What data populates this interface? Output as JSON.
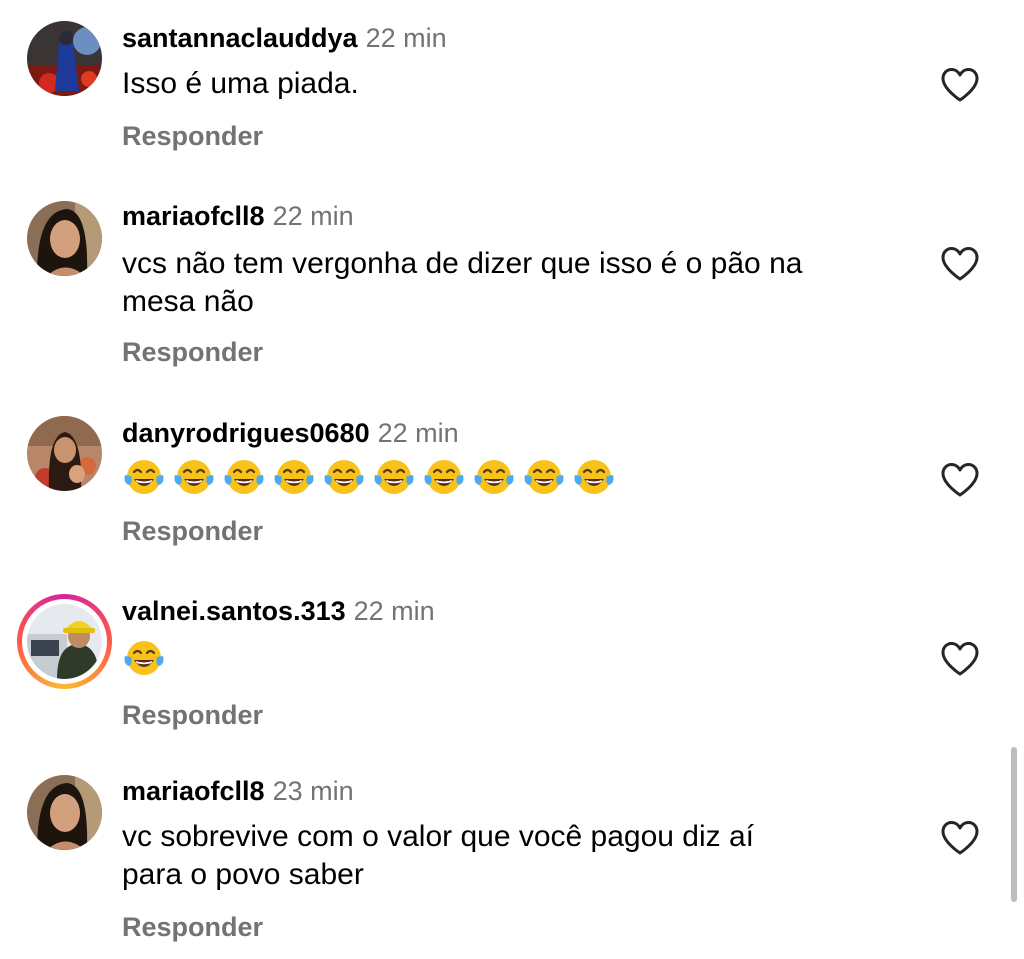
{
  "comments": [
    {
      "username": "santannaclauddya",
      "time": "22 min",
      "text": "Isso é uma piada.",
      "reply_label": "Responder"
    },
    {
      "username": "mariaofcll8",
      "time": "22 min",
      "text_line1": "vcs não tem vergonha de dizer que isso é o pão na",
      "text_line2": "mesa não",
      "reply_label": "Responder"
    },
    {
      "username": "danyrodrigues0680",
      "time": "22 min",
      "emoji": "face-with-tears-of-joy",
      "emoji_count": 10,
      "reply_label": "Responder"
    },
    {
      "username": "valnei.santos.313",
      "time": "22 min",
      "emoji": "face-with-tears-of-joy",
      "emoji_count": 1,
      "has_story_ring": true,
      "reply_label": "Responder"
    },
    {
      "username": "mariaofcll8",
      "time": "23 min",
      "text_line1": "vc sobrevive com o valor que você pagou diz aí",
      "text_line2": "para o povo saber",
      "reply_label": "Responder"
    }
  ],
  "colors": {
    "text": "#000000",
    "secondary": "#737373",
    "heart_outline": "#262626",
    "story_ring": [
      "#d6249f",
      "#fd5949",
      "#fdb934"
    ]
  },
  "icons": {
    "like": "heart-outline-icon",
    "emoji": "face-with-tears-of-joy-icon"
  }
}
